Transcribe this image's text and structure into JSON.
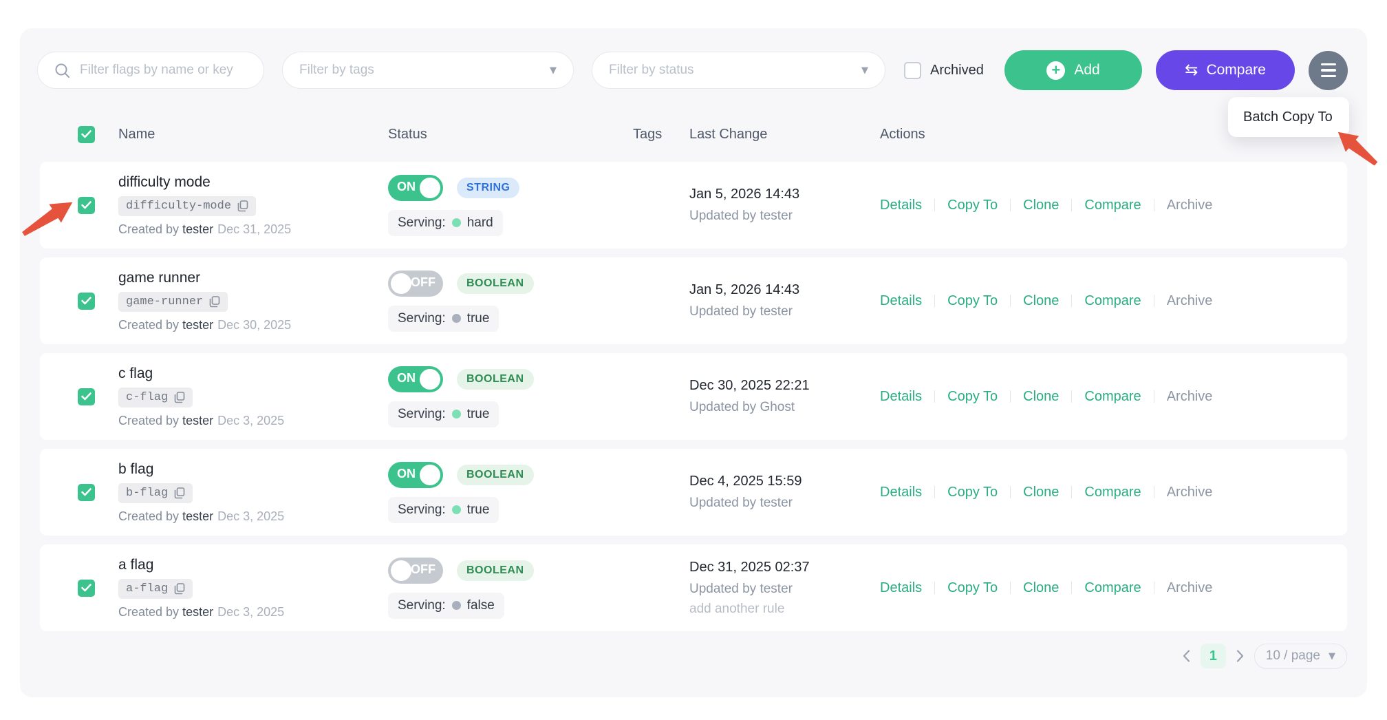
{
  "colors": {
    "accent_green": "#3cc28d",
    "accent_purple": "#6847e8",
    "link_green": "#2aad83",
    "badge_string_bg": "#dbeafb",
    "badge_string_text": "#2e6fe0",
    "badge_boolean_bg": "#e6f3e8",
    "badge_boolean_text": "#2c8c52",
    "annotation_red": "#e5533c",
    "card_bg": "#f7f7f9"
  },
  "filters": {
    "search_placeholder": "Filter flags by name or key",
    "tags_placeholder": "Filter by tags",
    "status_placeholder": "Filter by status",
    "archived_label": "Archived",
    "archived_state": "unchecked"
  },
  "toolbar": {
    "add_label": "Add",
    "compare_label": "Compare",
    "compare_icon": "⇆",
    "batch_menu_label": "Batch Copy To"
  },
  "table": {
    "select_all_state": "checked",
    "headers": {
      "name": "Name",
      "status": "Status",
      "tags": "Tags",
      "last_change": "Last Change",
      "actions": "Actions"
    }
  },
  "labels": {
    "created_by": "Created by",
    "serving": "Serving:"
  },
  "actions": {
    "details": "Details",
    "copy_to": "Copy To",
    "clone": "Clone",
    "compare": "Compare",
    "archive": "Archive"
  },
  "rows": [
    {
      "selected": "checked",
      "name": "difficulty mode",
      "key": "difficulty-mode",
      "created_by": "tester",
      "created_date": "Dec 31, 2025",
      "toggle_label": "ON",
      "toggle_state": "on",
      "type_label": "STRING",
      "type_state": "string",
      "serving_value": "hard",
      "changed_at": "Jan 5, 2026 14:43",
      "updated_by": "Updated by tester",
      "extra": ""
    },
    {
      "selected": "checked",
      "name": "game runner",
      "key": "game-runner",
      "created_by": "tester",
      "created_date": "Dec 30, 2025",
      "toggle_label": "OFF",
      "toggle_state": "off",
      "type_label": "BOOLEAN",
      "type_state": "boolean",
      "serving_value": "true",
      "changed_at": "Jan 5, 2026 14:43",
      "updated_by": "Updated by tester",
      "extra": ""
    },
    {
      "selected": "checked",
      "name": "c flag",
      "key": "c-flag",
      "created_by": "tester",
      "created_date": "Dec 3, 2025",
      "toggle_label": "ON",
      "toggle_state": "on",
      "type_label": "BOOLEAN",
      "type_state": "boolean",
      "serving_value": "true",
      "changed_at": "Dec 30, 2025 22:21",
      "updated_by": "Updated by Ghost",
      "extra": ""
    },
    {
      "selected": "checked",
      "name": "b flag",
      "key": "b-flag",
      "created_by": "tester",
      "created_date": "Dec 3, 2025",
      "toggle_label": "ON",
      "toggle_state": "on",
      "type_label": "BOOLEAN",
      "type_state": "boolean",
      "serving_value": "true",
      "changed_at": "Dec 4, 2025 15:59",
      "updated_by": "Updated by tester",
      "extra": ""
    },
    {
      "selected": "checked",
      "name": "a flag",
      "key": "a-flag",
      "created_by": "tester",
      "created_date": "Dec 3, 2025",
      "toggle_label": "OFF",
      "toggle_state": "off",
      "type_label": "BOOLEAN",
      "type_state": "boolean",
      "serving_value": "false",
      "changed_at": "Dec 31, 2025 02:37",
      "updated_by": "Updated by tester",
      "extra": "add another rule"
    }
  ],
  "pagination": {
    "current_page": "1",
    "page_size": "10 / page"
  }
}
